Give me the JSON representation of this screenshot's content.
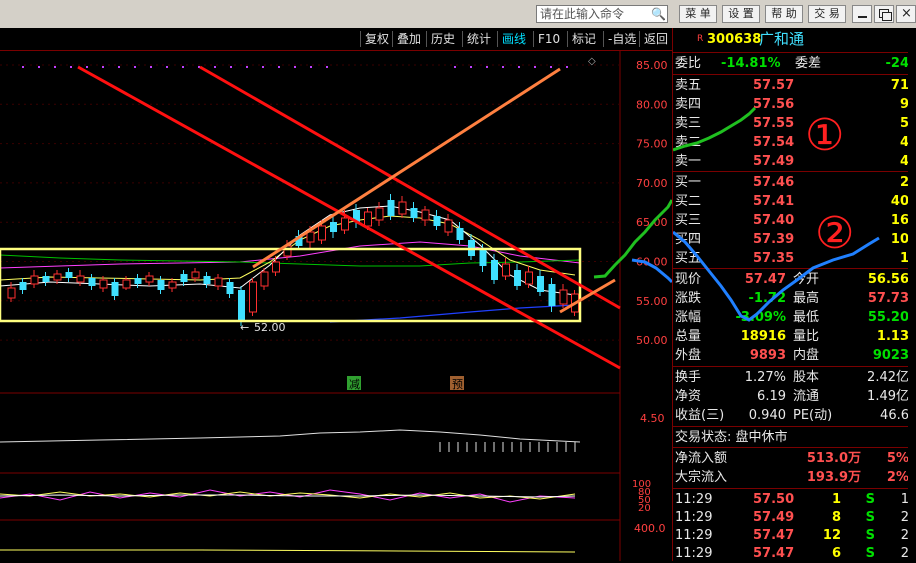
{
  "command_input": {
    "placeholder": "请在此输入命令"
  },
  "toolbar": {
    "menu": "菜 单",
    "settings": "设 置",
    "help": "帮 助",
    "trade": "交 易"
  },
  "menubar": [
    "复权",
    "叠加",
    "历史",
    "统计",
    "画线",
    "F10",
    "标记",
    "-自选",
    "返回"
  ],
  "chart": {
    "price_ticks": [
      "85.00",
      "80.00",
      "75.00",
      "70.00",
      "65.00",
      "60.00",
      "55.00",
      "50.00"
    ],
    "low_label": "52.00",
    "marker_reduce": "减",
    "marker_forecast": "预",
    "vol_tick": "4.50",
    "ind_ticks": [
      "100",
      "80",
      "50",
      "20"
    ],
    "bottom_tick": "400.0"
  },
  "stock": {
    "badge": "R",
    "code": "300638",
    "name": "广和通"
  },
  "weibi": {
    "label": "委比",
    "value": "-14.81%",
    "label2": "委差",
    "value2": "-24"
  },
  "asks": [
    {
      "label": "卖五",
      "price": "57.57",
      "vol": "71"
    },
    {
      "label": "卖四",
      "price": "57.56",
      "vol": "9"
    },
    {
      "label": "卖三",
      "price": "57.55",
      "vol": "5"
    },
    {
      "label": "卖二",
      "price": "57.54",
      "vol": "4"
    },
    {
      "label": "卖一",
      "price": "57.49",
      "vol": "4"
    }
  ],
  "bids": [
    {
      "label": "买一",
      "price": "57.46",
      "vol": "2"
    },
    {
      "label": "买二",
      "price": "57.41",
      "vol": "40"
    },
    {
      "label": "买三",
      "price": "57.40",
      "vol": "16"
    },
    {
      "label": "买四",
      "price": "57.39",
      "vol": "10"
    },
    {
      "label": "买五",
      "price": "57.35",
      "vol": "1"
    }
  ],
  "quote": [
    {
      "l1": "现价",
      "v1": "57.47",
      "l2": "今开",
      "v2": "56.56"
    },
    {
      "l1": "涨跌",
      "v1": "-1.72",
      "l2": "最高",
      "v2": "57.73"
    },
    {
      "l1": "涨幅",
      "v1": "-3.09%",
      "l2": "最低",
      "v2": "55.20"
    },
    {
      "l1": "总量",
      "v1": "18916",
      "l2": "量比",
      "v2": "1.13"
    },
    {
      "l1": "外盘",
      "v1": "9893",
      "l2": "内盘",
      "v2": "9023"
    }
  ],
  "stats": [
    {
      "l1": "换手",
      "v1": "1.27%",
      "l2": "股本",
      "v2": "2.42亿"
    },
    {
      "l1": "净资",
      "v1": "6.19",
      "l2": "流通",
      "v2": "1.49亿"
    },
    {
      "l1": "收益(三)",
      "v1": "0.940",
      "l2": "PE(动)",
      "v2": "46.6"
    }
  ],
  "trade_status": "交易状态: 盘中休市",
  "flows": [
    {
      "label": "净流入额",
      "value": "513.0万",
      "pct": "5%"
    },
    {
      "label": "大宗流入",
      "value": "193.9万",
      "pct": "2%"
    }
  ],
  "ticks": [
    {
      "time": "11:29",
      "price": "57.50",
      "vol": "1",
      "side": "S",
      "n": "1"
    },
    {
      "time": "11:29",
      "price": "57.49",
      "vol": "8",
      "side": "S",
      "n": "2"
    },
    {
      "time": "11:29",
      "price": "57.47",
      "vol": "12",
      "side": "S",
      "n": "2"
    },
    {
      "time": "11:29",
      "price": "57.47",
      "vol": "6",
      "side": "S",
      "n": "2"
    }
  ],
  "annotations": {
    "circle1": "①",
    "circle2": "②"
  },
  "colors": {
    "up": "#ff3030",
    "down": "#40e0ff",
    "frame": "#7a0000",
    "highlight_box": "#ffff80"
  }
}
